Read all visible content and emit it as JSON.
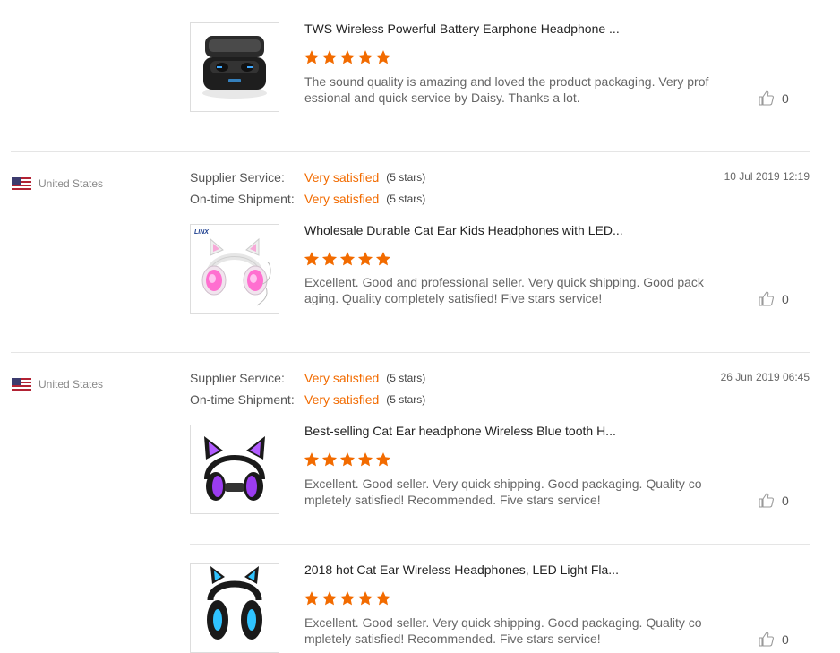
{
  "colors": {
    "accent": "#f26b00",
    "star": "#f26b00",
    "divider": "#e5e5e5"
  },
  "labels": {
    "supplier_service": "Supplier Service:",
    "ontime_shipment": "On-time Shipment:"
  },
  "reviews": [
    {
      "country": "United States",
      "date": "10 Jul 2019 12:19",
      "supplier_service": {
        "value": "Very satisfied",
        "stars": "(5 stars)"
      },
      "ontime_shipment": {
        "value": "Very satisfied",
        "stars": "(5 stars)"
      }
    },
    {
      "country": "United States",
      "date": "26 Jun 2019 06:45",
      "supplier_service": {
        "value": "Very satisfied",
        "stars": "(5 stars)"
      },
      "ontime_shipment": {
        "value": "Very satisfied",
        "stars": "(5 stars)"
      }
    }
  ],
  "products": [
    {
      "title": "TWS Wireless Powerful Battery Earphone Headphone ...",
      "rating": 5,
      "comment": "The sound quality is amazing and loved the product packaging. Very professional and quick service by Daisy. Thanks a lot.",
      "likes": "0",
      "image_icon": "earbuds-case"
    },
    {
      "title": "Wholesale Durable Cat Ear Kids Headphones with LED...",
      "rating": 5,
      "comment": "Excellent. Good and professional seller. Very quick shipping. Good packaging. Quality completely satisfied! Five stars service!",
      "likes": "0",
      "image_icon": "pink-cat-headphones",
      "image_brand": "LINX"
    },
    {
      "title": "Best-selling Cat Ear headphone Wireless Blue tooth H...",
      "rating": 5,
      "comment": "Excellent. Good seller. Very quick shipping. Good packaging. Quality completely satisfied! Recommended. Five stars service!",
      "likes": "0",
      "image_icon": "purple-cat-headphones"
    },
    {
      "title": "2018 hot Cat Ear Wireless Headphones, LED Light Fla...",
      "rating": 5,
      "comment": "Excellent. Good seller. Very quick shipping. Good packaging. Quality completely satisfied! Recommended. Five stars service!",
      "likes": "0",
      "image_icon": "blue-cat-headphones"
    }
  ]
}
